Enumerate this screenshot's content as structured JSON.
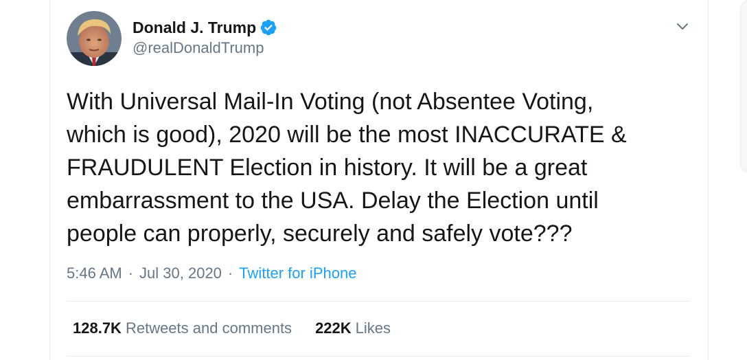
{
  "author": {
    "display_name": "Donald J. Trump",
    "handle": "@realDonaldTrump",
    "verified": true
  },
  "tweet": {
    "lines": [
      "With Universal Mail-In Voting (not Absentee Voting,",
      "which is good), 2020 will be the most INACCURATE &",
      "FRAUDULENT Election in history. It will be a great",
      "embarrassment to the USA. Delay the Election until",
      "people can properly, securely and safely vote???"
    ]
  },
  "meta": {
    "time": "5:46 AM",
    "separator": "·",
    "date": "Jul 30, 2020",
    "source": "Twitter for iPhone"
  },
  "stats": {
    "retweets_count": "128.7K",
    "retweets_label": "Retweets and comments",
    "likes_count": "222K",
    "likes_label": "Likes"
  },
  "colors": {
    "text": "#14171a",
    "secondary": "#657786",
    "accent": "#1da1f2",
    "divider": "#e6ecf0"
  },
  "icons": {
    "verified": "verified-badge-icon",
    "caret": "chevron-down-icon"
  }
}
